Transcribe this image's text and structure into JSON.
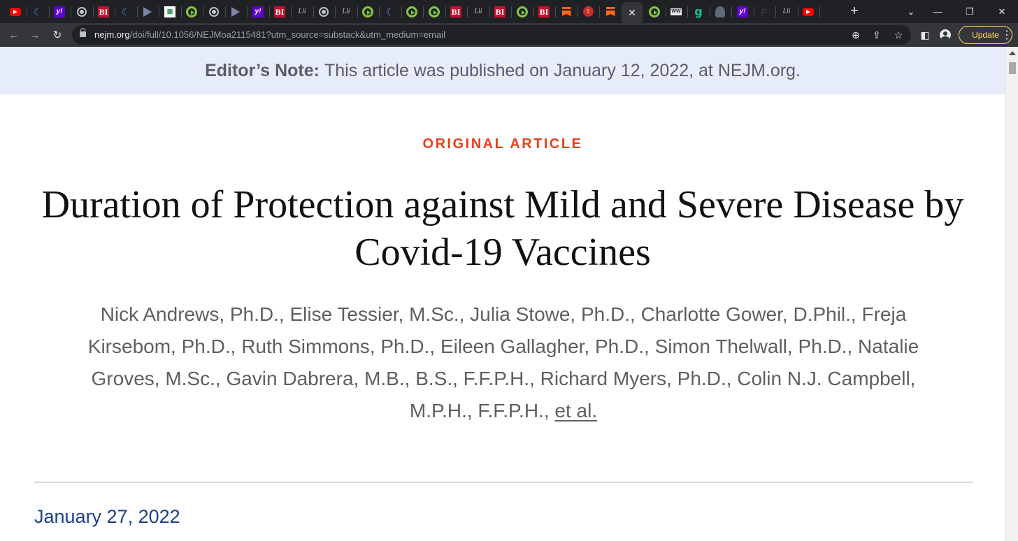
{
  "browser": {
    "tabs": [
      {
        "icon": "youtube-icon",
        "glyph": ""
      },
      {
        "icon": "shield-icon",
        "glyph": "☾"
      },
      {
        "icon": "yahoo-icon",
        "glyph": "y!"
      },
      {
        "icon": "globe-icon",
        "glyph": ""
      },
      {
        "icon": "business-insider-icon",
        "glyph": "BI"
      },
      {
        "icon": "shield-icon",
        "glyph": "☾"
      },
      {
        "icon": "arrow-icon",
        "glyph": ""
      },
      {
        "icon": "grid-icon",
        "glyph": "▦"
      },
      {
        "icon": "rumble-icon",
        "glyph": ""
      },
      {
        "icon": "globe-icon",
        "glyph": ""
      },
      {
        "icon": "arrow-icon",
        "glyph": ""
      },
      {
        "icon": "yahoo-icon",
        "glyph": "y!"
      },
      {
        "icon": "business-insider-icon",
        "glyph": "BI"
      },
      {
        "icon": "ll-icon",
        "glyph": "Lli"
      },
      {
        "icon": "globe-icon",
        "glyph": ""
      },
      {
        "icon": "ll-icon",
        "glyph": "Lli"
      },
      {
        "icon": "rumble-icon",
        "glyph": ""
      },
      {
        "icon": "shield-icon",
        "glyph": "☾"
      },
      {
        "icon": "rumble-icon",
        "glyph": ""
      },
      {
        "icon": "rumble-icon",
        "glyph": ""
      },
      {
        "icon": "business-insider-icon",
        "glyph": "BI"
      },
      {
        "icon": "ll-icon",
        "glyph": "Lli"
      },
      {
        "icon": "business-insider-icon",
        "glyph": "BI"
      },
      {
        "icon": "rumble-icon",
        "glyph": ""
      },
      {
        "icon": "business-insider-icon",
        "glyph": "BI"
      },
      {
        "icon": "substack-icon",
        "glyph": ""
      },
      {
        "icon": "podcast-icon",
        "glyph": "♀"
      },
      {
        "icon": "substack-icon",
        "glyph": ""
      },
      {
        "icon": "close-icon",
        "glyph": "✕",
        "active": true
      },
      {
        "icon": "rumble-icon",
        "glyph": ""
      },
      {
        "icon": "ww-icon",
        "glyph": "WW"
      },
      {
        "icon": "grammarly-icon",
        "glyph": "g"
      },
      {
        "icon": "person-icon",
        "glyph": ""
      },
      {
        "icon": "yahoo-icon",
        "glyph": "y!"
      },
      {
        "icon": "p-icon",
        "glyph": "P"
      },
      {
        "icon": "ll-icon",
        "glyph": "Lli"
      },
      {
        "icon": "youtube-icon",
        "glyph": ""
      }
    ],
    "new_tab_glyph": "+",
    "window_controls": {
      "search_tabs": "⌄",
      "minimize": "—",
      "restore": "❐",
      "close": "✕"
    },
    "nav": {
      "back": "←",
      "forward": "→",
      "reload": "↻"
    },
    "url": {
      "host": "nejm.org",
      "path": "/doi/full/10.1056/NEJMoa2115481?utm_source=substack&utm_medium=email"
    },
    "omnibox_icons": {
      "zoom": "⊕",
      "share": "⇪",
      "bookmark": "☆"
    },
    "toolbar_icons": {
      "side_panel": "◧"
    },
    "update_label": "Update",
    "menu_glyph": "⋮",
    "colors": {
      "frame": "#202124",
      "toolbar": "#35363a",
      "update_accent": "#fdd663"
    }
  },
  "page": {
    "editor_note": {
      "label": "Editor’s Note:",
      "text": "This article was published on January 12, 2022, at NEJM.org."
    },
    "kicker": "ORIGINAL ARTICLE",
    "title": "Duration of Protection against Mild and Severe Disease by Covid-19 Vaccines",
    "authors": "Nick Andrews, Ph.D., Elise Tessier, M.Sc., Julia Stowe, Ph.D., Charlotte Gower, D.Phil., Freja Kirsebom, Ph.D., Ruth Simmons, Ph.D., Eileen Gallagher, Ph.D., Simon Thelwall, Ph.D., Natalie Groves, M.Sc., Gavin Dabrera, M.B., B.S., F.F.P.H., Richard Myers, Ph.D., Colin N.J. Campbell, M.P.H., F.F.P.H.,",
    "et_al": "et al.",
    "publication_date": "January 27, 2022",
    "colors": {
      "kicker": "#e8401c",
      "date": "#1d4189",
      "note_bg": "#e7ecfa"
    }
  }
}
